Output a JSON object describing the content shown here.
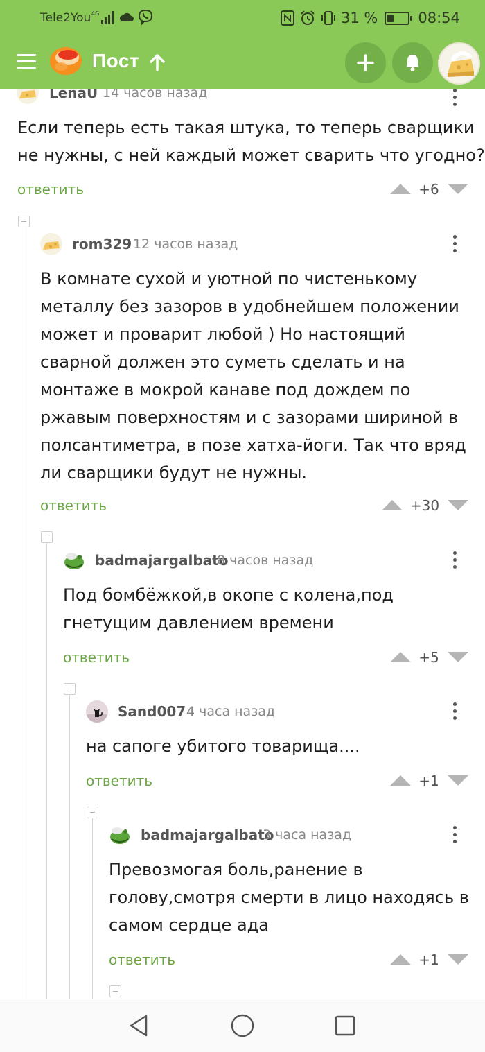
{
  "status_bar": {
    "carrier": "Tele2You",
    "network": "4G",
    "battery_percent": "31 %",
    "battery_level": 0.31,
    "time": "08:54",
    "icons": [
      "signal-icon",
      "cloud-icon",
      "viber-icon",
      "nfc-icon",
      "alarm-icon",
      "vibrate-icon",
      "battery-icon"
    ]
  },
  "header": {
    "title": "Пост",
    "icons": [
      "menu-icon",
      "pikabu-logo",
      "scroll-up-icon",
      "add-icon",
      "bell-icon",
      "avatar"
    ]
  },
  "colors": {
    "header_bg": "#8ac858",
    "accent_green": "#6ba642",
    "button_bg": "#74b049"
  },
  "comments": [
    {
      "author": "LenaU",
      "time": "14 часов назад",
      "lines": [
        "Если теперь есть такая штука, то теперь сварщики",
        "не нужны, с ней каждый может сварить что угодно?"
      ],
      "reply_label": "ответить",
      "score": "+6"
    },
    {
      "author": "rom329",
      "time": "12 часов назад",
      "lines": [
        "В комнате сухой и уютной по чистенькому",
        "металлу без зазоров в удобнейшем положении",
        "может и проварит любой ) Но настоящий",
        "сварной должен это суметь сделать и на",
        "монтаже в мокрой канаве под дождем по",
        "ржавым поверхностям и с зазорами шириной в",
        "полсантиметра, в позе хатха-йоги. Так что вряд",
        "ли сварщики будут не нужны."
      ],
      "reply_label": "ответить",
      "score": "+30"
    },
    {
      "author": "badmajargalbato",
      "time": "8 часов назад",
      "lines": [
        "Под бомбёжкой,в окопе с колена,под",
        "гнетущим давлением времени"
      ],
      "reply_label": "ответить",
      "score": "+5"
    },
    {
      "author": "Sand007",
      "time": "4 часа назад",
      "lines": [
        "на сапоге убитого товарища...."
      ],
      "reply_label": "ответить",
      "score": "+1"
    },
    {
      "author": "badmajargalbato",
      "time": "3 часа назад",
      "lines": [
        "Превозмогая боль,ранение в",
        "голову,смотря смерти в лицо находясь в",
        "самом сердце ада"
      ],
      "reply_label": "ответить",
      "score": "+1"
    }
  ],
  "nav_bar": {
    "icons": [
      "back-icon",
      "home-icon",
      "recents-icon"
    ]
  }
}
